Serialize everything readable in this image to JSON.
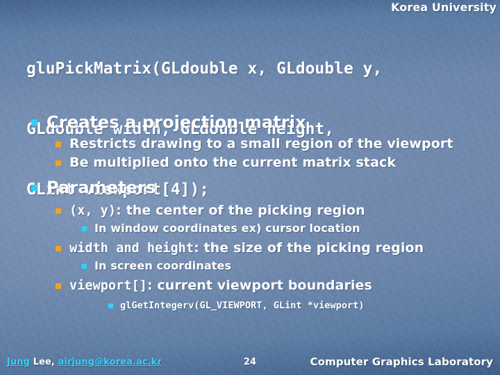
{
  "header": {
    "organization": "Korea University"
  },
  "title": {
    "line1": "gluPickMatrix(GLdouble x, GLdouble y,",
    "line2": "GLdouble width, GLdouble height,",
    "line3": "GLint viewport[4]);"
  },
  "colors": {
    "bullet_level1": "#2fd0f7",
    "bullet_level2": "#f0a323",
    "bullet_level3": "#2fd0f7",
    "bullet_level4": "#2fd0f7",
    "text": "#ffffff",
    "link": "#32d2fa",
    "background": "#6d87ad"
  },
  "content": [
    {
      "level": 1,
      "bullet": "square-bullet-cyan",
      "text": "Creates a projection matrix",
      "mono_prefix": ""
    },
    {
      "level": 2,
      "bullet": "square-bullet-gold",
      "text": "Restricts drawing to a small region of the viewport",
      "mono_prefix": ""
    },
    {
      "level": 2,
      "bullet": "square-bullet-gold",
      "text": "Be multiplied onto the current matrix stack",
      "mono_prefix": ""
    },
    {
      "level": 1,
      "bullet": "square-bullet-cyan",
      "text": "Parameters",
      "mono_prefix": ""
    },
    {
      "level": 2,
      "bullet": "square-bullet-gold",
      "mono_prefix": "(x, y)",
      "text": ": the center of the picking region"
    },
    {
      "level": 3,
      "bullet": "square-bullet-cyan",
      "mono_prefix": "",
      "text": "In window coordinates   ex) cursor location"
    },
    {
      "level": 2,
      "bullet": "square-bullet-gold",
      "mono_prefix": "width and height",
      "text": ": the size of the picking region"
    },
    {
      "level": 3,
      "bullet": "square-bullet-cyan",
      "mono_prefix": "",
      "text": "In screen coordinates"
    },
    {
      "level": 2,
      "bullet": "square-bullet-gold",
      "mono_prefix": "viewport[]",
      "text": ": current viewport boundaries"
    },
    {
      "level": 4,
      "bullet": "square-bullet-cyan",
      "mono_prefix": "glGetIntegerv(GL_VIEWPORT, GLint *viewport)",
      "text": ""
    }
  ],
  "footer": {
    "author_link1": "Jung",
    "author_mid": " Lee, ",
    "author_link2": "airjung@korea.ac.kr",
    "page_number": "24",
    "lab": "Computer Graphics Laboratory"
  }
}
